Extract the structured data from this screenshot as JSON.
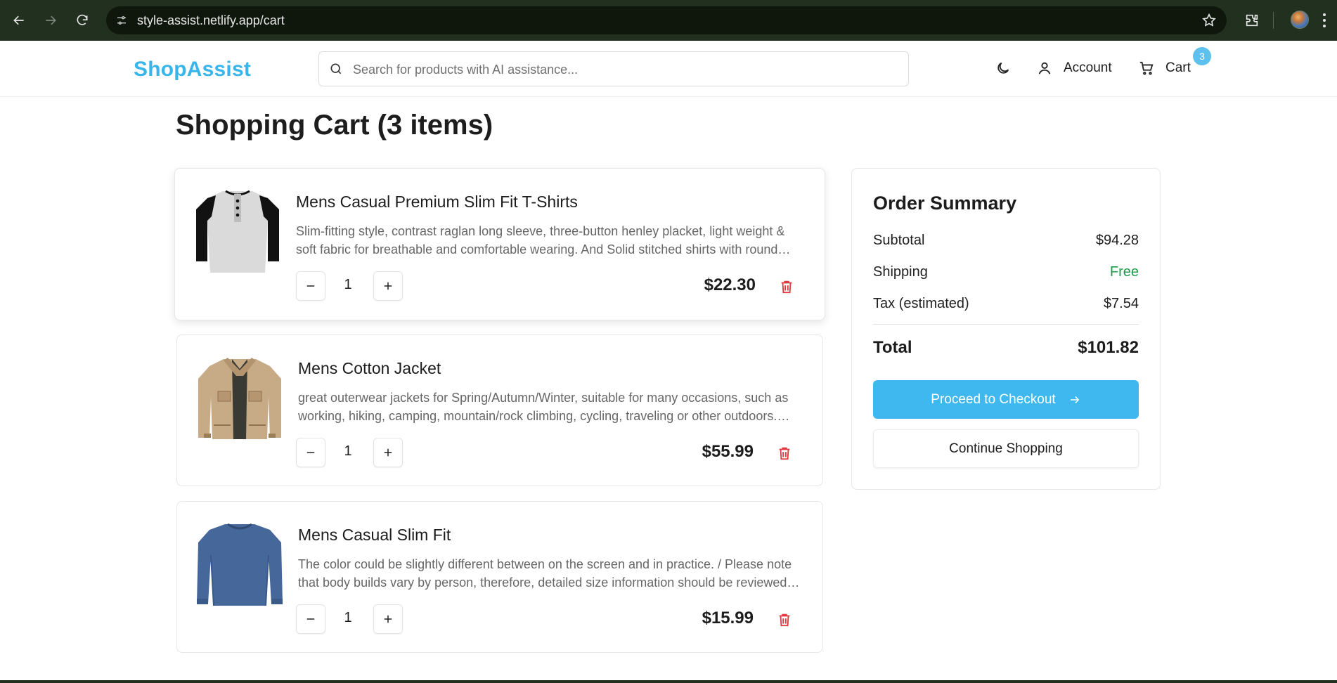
{
  "browser": {
    "url": "style-assist.netlify.app/cart"
  },
  "header": {
    "logo": "ShopAssist",
    "search_placeholder": "Search for products with AI assistance...",
    "search_value": "",
    "account_label": "Account",
    "cart_label": "Cart",
    "cart_count": "3"
  },
  "page": {
    "title": "Shopping Cart (3 items)"
  },
  "items": [
    {
      "name": "Mens Casual Premium Slim Fit T-Shirts",
      "description": "Slim-fitting style, contrast raglan long sleeve, three-button henley placket, light weight & soft fabric for breathable and comfortable wearing. And Solid stitched shirts with round neck made for durability and a great fit for casual fashion wear and diehard baseball fans.",
      "quantity": "1",
      "price": "$22.30"
    },
    {
      "name": "Mens Cotton Jacket",
      "description": "great outerwear jackets for Spring/Autumn/Winter, suitable for many occasions, such as working, hiking, camping, mountain/rock climbing, cycling, traveling or other outdoors. Good gift choice for you or your family member.",
      "quantity": "1",
      "price": "$55.99"
    },
    {
      "name": "Mens Casual Slim Fit",
      "description": "The color could be slightly different between on the screen and in practice. / Please note that body builds vary by person, therefore, detailed size information should be reviewed below on the product description.",
      "quantity": "1",
      "price": "$15.99"
    }
  ],
  "summary": {
    "title": "Order Summary",
    "subtotal_label": "Subtotal",
    "subtotal_value": "$94.28",
    "shipping_label": "Shipping",
    "shipping_value": "Free",
    "tax_label": "Tax (estimated)",
    "tax_value": "$7.54",
    "total_label": "Total",
    "total_value": "$101.82",
    "checkout_label": "Proceed to Checkout",
    "continue_label": "Continue Shopping"
  },
  "colors": {
    "brand": "#38b6ec",
    "checkout_button": "#3fb7ef",
    "shipping_free": "#1f9a4c",
    "delete_icon": "#e0383e",
    "browser_frame": "#22301f"
  },
  "icons": [
    "back-arrow-icon",
    "forward-arrow-icon",
    "reload-icon",
    "site-info-icon",
    "bookmark-star-icon",
    "extensions-icon",
    "profile-avatar",
    "chrome-menu-icon",
    "search-icon",
    "moon-icon",
    "user-icon",
    "cart-icon",
    "minus-icon",
    "plus-icon",
    "trash-icon",
    "arrow-right-icon"
  ]
}
